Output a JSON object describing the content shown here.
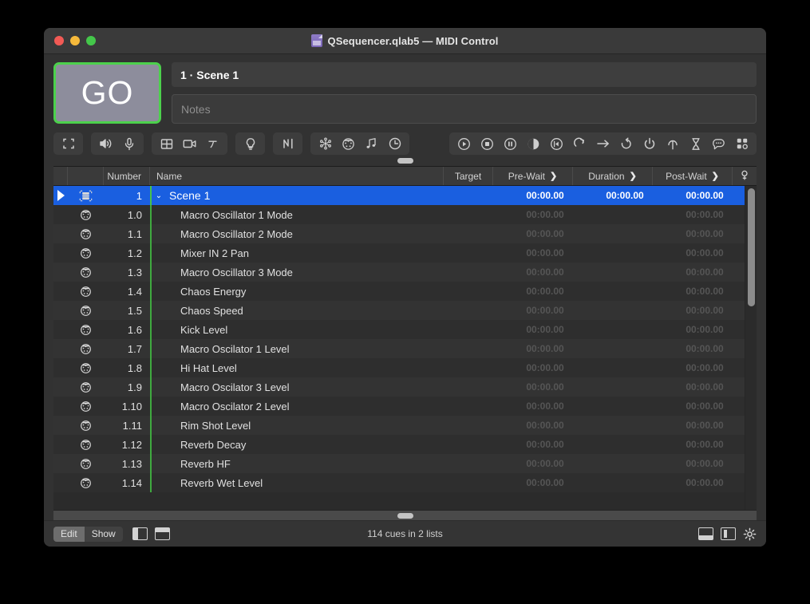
{
  "window": {
    "title": "QSequencer.qlab5 — MIDI Control",
    "doc_icon": "qlab-document-icon",
    "traffic": {
      "close": "close",
      "minimize": "minimize",
      "zoom": "zoom"
    }
  },
  "go": {
    "label": "GO",
    "border_color": "#4cd14c",
    "fill_color": "#8d8d9c"
  },
  "fields": {
    "cue_name": "1 · Scene 1",
    "notes_placeholder": "Notes"
  },
  "toolbar": {
    "groups": [
      {
        "name": "group-fullscreen",
        "buttons": [
          {
            "name": "fullscreen-icon",
            "glyph": "fullscreen"
          }
        ]
      },
      {
        "name": "group-audio",
        "buttons": [
          {
            "name": "speaker-icon",
            "glyph": "speaker"
          },
          {
            "name": "microphone-icon",
            "glyph": "mic"
          }
        ]
      },
      {
        "name": "group-video",
        "buttons": [
          {
            "name": "video-panel-icon",
            "glyph": "panel"
          },
          {
            "name": "camera-icon",
            "glyph": "camera"
          },
          {
            "name": "text-icon",
            "glyph": "text"
          }
        ]
      },
      {
        "name": "group-light",
        "buttons": [
          {
            "name": "light-bulb-icon",
            "glyph": "bulb"
          }
        ]
      },
      {
        "name": "group-network",
        "buttons": [
          {
            "name": "network-icon",
            "glyph": "network"
          }
        ]
      },
      {
        "name": "group-control",
        "buttons": [
          {
            "name": "midi-snowflake-icon",
            "glyph": "snowflake"
          },
          {
            "name": "midi-din-icon",
            "glyph": "midi"
          },
          {
            "name": "music-note-icon",
            "glyph": "note"
          },
          {
            "name": "timecode-clock-icon",
            "glyph": "clock"
          }
        ]
      },
      {
        "name": "group-transport",
        "buttons": [
          {
            "name": "start-icon",
            "glyph": "play"
          },
          {
            "name": "stop-icon",
            "glyph": "stop"
          },
          {
            "name": "pause-icon",
            "glyph": "pause"
          },
          {
            "name": "fade-icon",
            "glyph": "fade"
          },
          {
            "name": "reset-icon",
            "glyph": "rewind"
          },
          {
            "name": "loop-icon",
            "glyph": "loop"
          },
          {
            "name": "goto-icon",
            "glyph": "arrow"
          },
          {
            "name": "devamp-icon",
            "glyph": "devamp"
          },
          {
            "name": "target-icon",
            "glyph": "power"
          },
          {
            "name": "arm-icon",
            "glyph": "arm"
          },
          {
            "name": "wait-icon",
            "glyph": "hourglass"
          },
          {
            "name": "memo-icon",
            "glyph": "memo"
          },
          {
            "name": "group-icon",
            "glyph": "grid"
          }
        ]
      }
    ]
  },
  "table": {
    "columns": [
      {
        "key": "flag",
        "label": ""
      },
      {
        "key": "icon",
        "label": ""
      },
      {
        "key": "number",
        "label": "Number"
      },
      {
        "key": "name",
        "label": "Name"
      },
      {
        "key": "target",
        "label": "Target"
      },
      {
        "key": "pre",
        "label": "Pre-Wait",
        "arrow": "❯"
      },
      {
        "key": "dur",
        "label": "Duration",
        "arrow": "❯"
      },
      {
        "key": "post",
        "label": "Post-Wait",
        "arrow": "❯"
      },
      {
        "key": "gear",
        "label": ""
      }
    ],
    "rows": [
      {
        "number": "1",
        "name": "Scene 1",
        "icon": "group-cue-icon",
        "pre": "00:00.00",
        "dur": "00:00.00",
        "post": "00:00.00",
        "selected": true,
        "playhead": true,
        "disclosure": "⌄",
        "top": true
      },
      {
        "number": "1.0",
        "name": "Macro Oscillator 1 Mode",
        "icon": "midi-din-icon",
        "pre": "00:00.00",
        "dur": "",
        "post": "00:00.00"
      },
      {
        "number": "1.1",
        "name": "Macro Oscillator 2 Mode",
        "icon": "midi-din-icon",
        "pre": "00:00.00",
        "dur": "",
        "post": "00:00.00"
      },
      {
        "number": "1.2",
        "name": "Mixer IN 2 Pan",
        "icon": "midi-din-icon",
        "pre": "00:00.00",
        "dur": "",
        "post": "00:00.00"
      },
      {
        "number": "1.3",
        "name": "Macro Oscillator 3 Mode",
        "icon": "midi-din-icon",
        "pre": "00:00.00",
        "dur": "",
        "post": "00:00.00"
      },
      {
        "number": "1.4",
        "name": "Chaos Energy",
        "icon": "midi-din-icon",
        "pre": "00:00.00",
        "dur": "",
        "post": "00:00.00"
      },
      {
        "number": "1.5",
        "name": "Chaos Speed",
        "icon": "midi-din-icon",
        "pre": "00:00.00",
        "dur": "",
        "post": "00:00.00"
      },
      {
        "number": "1.6",
        "name": "Kick Level",
        "icon": "midi-din-icon",
        "pre": "00:00.00",
        "dur": "",
        "post": "00:00.00"
      },
      {
        "number": "1.7",
        "name": "Macro Oscilator 1 Level",
        "icon": "midi-din-icon",
        "pre": "00:00.00",
        "dur": "",
        "post": "00:00.00"
      },
      {
        "number": "1.8",
        "name": "Hi Hat Level",
        "icon": "midi-din-icon",
        "pre": "00:00.00",
        "dur": "",
        "post": "00:00.00"
      },
      {
        "number": "1.9",
        "name": "Macro Oscilator 3 Level",
        "icon": "midi-din-icon",
        "pre": "00:00.00",
        "dur": "",
        "post": "00:00.00"
      },
      {
        "number": "1.10",
        "name": "Macro Oscilator 2 Level",
        "icon": "midi-din-icon",
        "pre": "00:00.00",
        "dur": "",
        "post": "00:00.00"
      },
      {
        "number": "1.11",
        "name": "Rim Shot Level",
        "icon": "midi-din-icon",
        "pre": "00:00.00",
        "dur": "",
        "post": "00:00.00"
      },
      {
        "number": "1.12",
        "name": "Reverb Decay",
        "icon": "midi-din-icon",
        "pre": "00:00.00",
        "dur": "",
        "post": "00:00.00"
      },
      {
        "number": "1.13",
        "name": "Reverb HF",
        "icon": "midi-din-icon",
        "pre": "00:00.00",
        "dur": "",
        "post": "00:00.00"
      },
      {
        "number": "1.14",
        "name": "Reverb Wet Level",
        "icon": "midi-din-icon",
        "pre": "00:00.00",
        "dur": "",
        "post": "00:00.00"
      }
    ]
  },
  "statusbar": {
    "edit_label": "Edit",
    "show_label": "Show",
    "active_mode": "Edit",
    "status_text": "114 cues in 2 lists",
    "left_icons": [
      {
        "name": "sidebar-toggle-icon"
      },
      {
        "name": "inspector-toggle-icon"
      }
    ],
    "right_icons": [
      {
        "name": "bottom-pane-toggle-icon"
      },
      {
        "name": "side-pane-toggle-icon"
      },
      {
        "name": "gear-icon"
      }
    ]
  },
  "colors": {
    "selection": "#1a5fe0",
    "go_green": "#4cd14c",
    "column_divider_green": "#3faa3f"
  }
}
